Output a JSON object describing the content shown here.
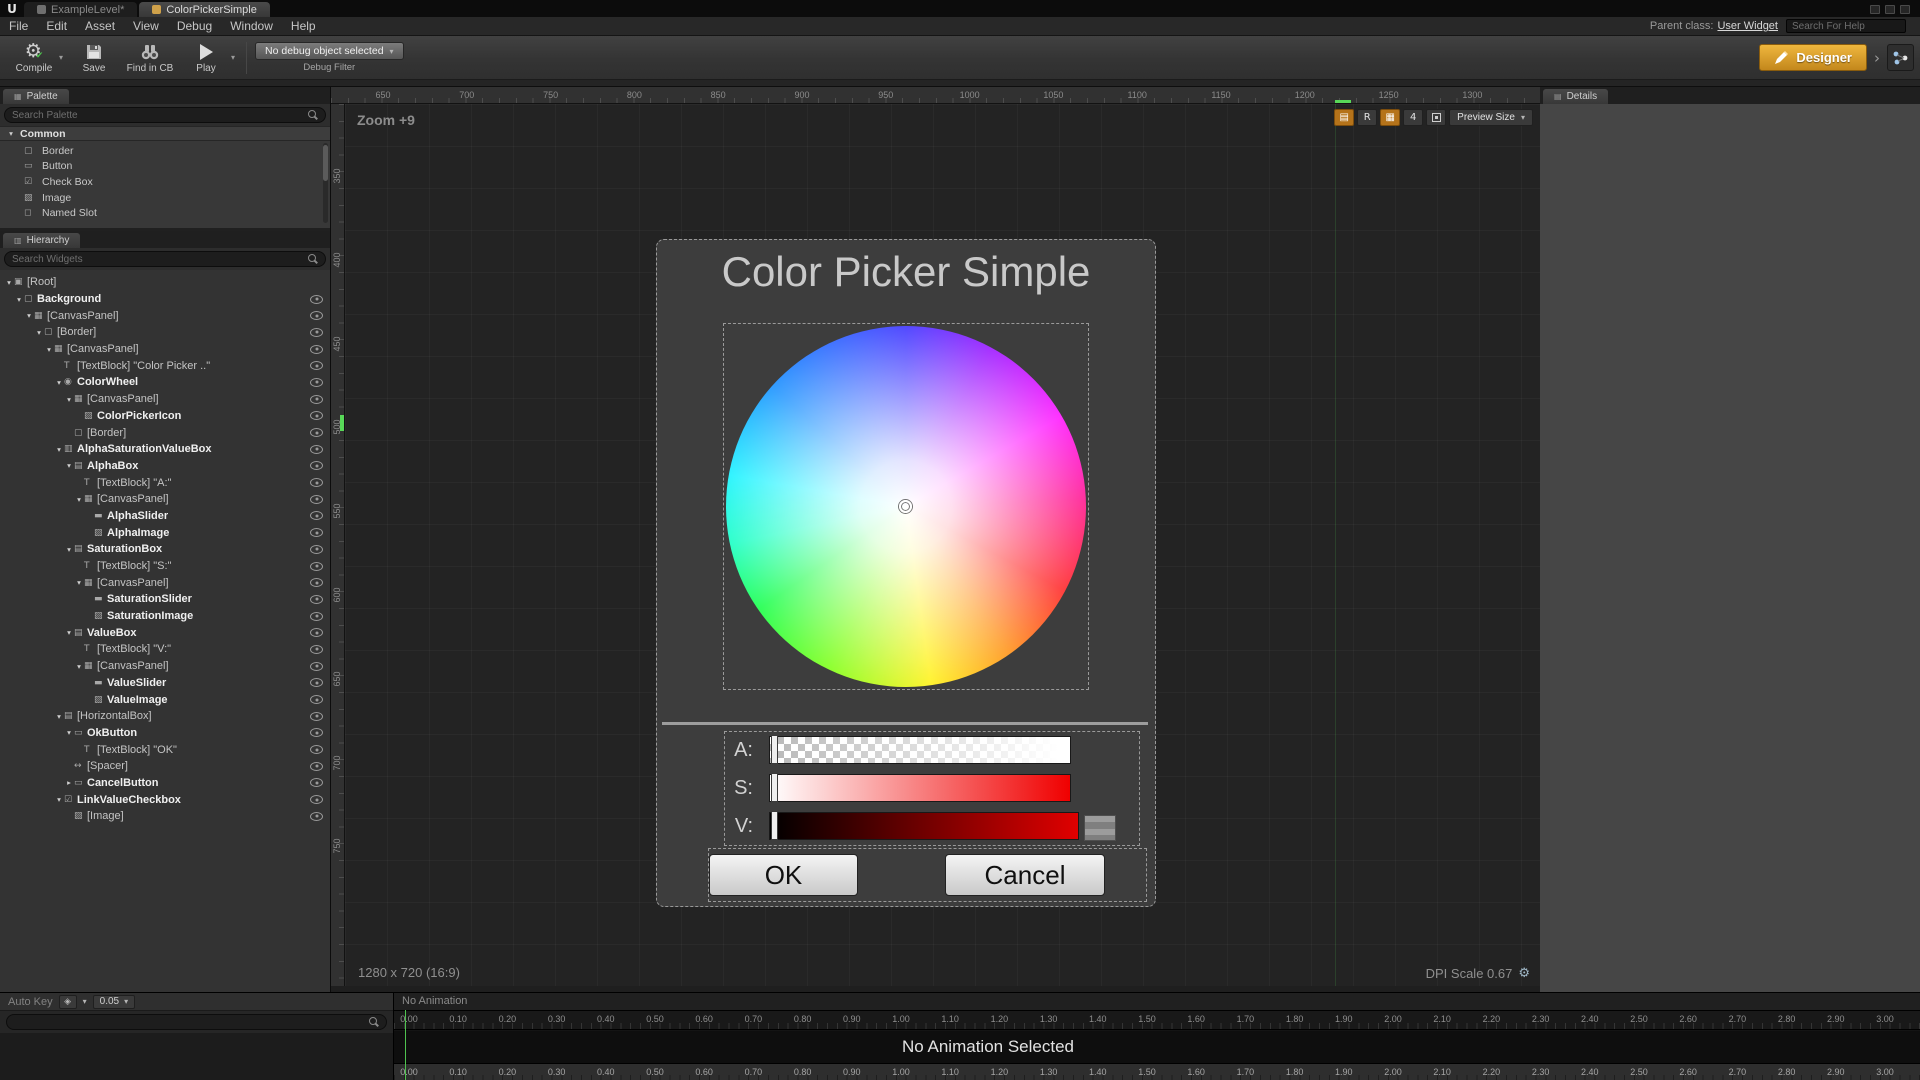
{
  "colors": {
    "accent_orange": "#c9861e",
    "playhead_green": "#4fc24f",
    "guide_green": "#58d858"
  },
  "window": {
    "logo_letter": "U",
    "tabs": [
      {
        "label": "ExampleLevel*"
      },
      {
        "label": "ColorPickerSimple"
      }
    ],
    "menus": [
      "File",
      "Edit",
      "Asset",
      "View",
      "Debug",
      "Window",
      "Help"
    ],
    "parent_class_label": "Parent class:",
    "parent_class_value": "User Widget",
    "help_search_placeholder": "Search For Help"
  },
  "toolbar": {
    "compile_label": "Compile",
    "save_label": "Save",
    "find_label": "Find in CB",
    "play_label": "Play",
    "debug_dropdown_value": "No debug object selected",
    "debug_filter_label": "Debug Filter",
    "designer_label": "Designer"
  },
  "palette": {
    "tab_label": "Palette",
    "search_placeholder": "Search Palette",
    "group_label": "Common",
    "items": [
      {
        "icon": "▢",
        "label": "Border"
      },
      {
        "icon": "▭",
        "label": "Button"
      },
      {
        "icon": "☑",
        "label": "Check Box"
      },
      {
        "icon": "▨",
        "label": "Image"
      },
      {
        "icon": "◻",
        "label": "Named Slot"
      }
    ]
  },
  "hierarchy": {
    "tab_label": "Hierarchy",
    "search_placeholder": "Search Widgets",
    "rows": [
      {
        "label": "[Root]",
        "depth": 0,
        "bold": false,
        "state": "e",
        "icon": "▣",
        "eye": false
      },
      {
        "label": "Background",
        "depth": 1,
        "bold": true,
        "state": "e",
        "icon": "▢"
      },
      {
        "label": "[CanvasPanel]",
        "depth": 2,
        "bold": false,
        "state": "e",
        "icon": "▦"
      },
      {
        "label": "[Border]",
        "depth": 3,
        "bold": false,
        "state": "e",
        "icon": "▢"
      },
      {
        "label": "[CanvasPanel]",
        "depth": 4,
        "bold": false,
        "state": "e",
        "icon": "▦"
      },
      {
        "label": "[TextBlock] \"Color Picker ..\"",
        "depth": 5,
        "bold": false,
        "state": "l",
        "icon": "T"
      },
      {
        "label": "ColorWheel",
        "depth": 5,
        "bold": true,
        "state": "e",
        "icon": "◉"
      },
      {
        "label": "[CanvasPanel]",
        "depth": 6,
        "bold": false,
        "state": "e",
        "icon": "▦"
      },
      {
        "label": "ColorPickerIcon",
        "depth": 7,
        "bold": true,
        "state": "l",
        "icon": "▨"
      },
      {
        "label": "[Border]",
        "depth": 6,
        "bold": false,
        "state": "l",
        "icon": "▢"
      },
      {
        "label": "AlphaSaturationValueBox",
        "depth": 5,
        "bold": true,
        "state": "e",
        "icon": "▥"
      },
      {
        "label": "AlphaBox",
        "depth": 6,
        "bold": true,
        "state": "e",
        "icon": "▤"
      },
      {
        "label": "[TextBlock] \"A:\"",
        "depth": 7,
        "bold": false,
        "state": "l",
        "icon": "T"
      },
      {
        "label": "[CanvasPanel]",
        "depth": 7,
        "bold": false,
        "state": "e",
        "icon": "▦"
      },
      {
        "label": "AlphaSlider",
        "depth": 8,
        "bold": true,
        "state": "l",
        "icon": "▬"
      },
      {
        "label": "AlphaImage",
        "depth": 8,
        "bold": true,
        "state": "l",
        "icon": "▨"
      },
      {
        "label": "SaturationBox",
        "depth": 6,
        "bold": true,
        "state": "e",
        "icon": "▤"
      },
      {
        "label": "[TextBlock] \"S:\"",
        "depth": 7,
        "bold": false,
        "state": "l",
        "icon": "T"
      },
      {
        "label": "[CanvasPanel]",
        "depth": 7,
        "bold": false,
        "state": "e",
        "icon": "▦"
      },
      {
        "label": "SaturationSlider",
        "depth": 8,
        "bold": true,
        "state": "l",
        "icon": "▬"
      },
      {
        "label": "SaturationImage",
        "depth": 8,
        "bold": true,
        "state": "l",
        "icon": "▨"
      },
      {
        "label": "ValueBox",
        "depth": 6,
        "bold": true,
        "state": "e",
        "icon": "▤"
      },
      {
        "label": "[TextBlock] \"V:\"",
        "depth": 7,
        "bold": false,
        "state": "l",
        "icon": "T"
      },
      {
        "label": "[CanvasPanel]",
        "depth": 7,
        "bold": false,
        "state": "e",
        "icon": "▦"
      },
      {
        "label": "ValueSlider",
        "depth": 8,
        "bold": true,
        "state": "l",
        "icon": "▬"
      },
      {
        "label": "ValueImage",
        "depth": 8,
        "bold": true,
        "state": "l",
        "icon": "▨"
      },
      {
        "label": "[HorizontalBox]",
        "depth": 5,
        "bold": false,
        "state": "e",
        "icon": "▤"
      },
      {
        "label": "OkButton",
        "depth": 6,
        "bold": true,
        "state": "e",
        "icon": "▭"
      },
      {
        "label": "[TextBlock] \"OK\"",
        "depth": 7,
        "bold": false,
        "state": "l",
        "icon": "T"
      },
      {
        "label": "[Spacer]",
        "depth": 6,
        "bold": false,
        "state": "l",
        "icon": "↔"
      },
      {
        "label": "CancelButton",
        "depth": 6,
        "bold": true,
        "state": "c",
        "icon": "▭"
      },
      {
        "label": "LinkValueCheckbox",
        "depth": 5,
        "bold": true,
        "state": "e",
        "icon": "☑"
      },
      {
        "label": "[Image]",
        "depth": 6,
        "bold": false,
        "state": "l",
        "icon": "▨"
      }
    ]
  },
  "designer": {
    "zoom_label": "Zoom +9",
    "h_ruler": [
      "650",
      "700",
      "750",
      "800",
      "850",
      "900",
      "950",
      "1000",
      "1050",
      "1100",
      "1150",
      "1200",
      "1250",
      "1300"
    ],
    "v_ruler": [
      "350",
      "400",
      "450",
      "500",
      "550",
      "600",
      "650",
      "700",
      "750"
    ],
    "view_toggles": [
      {
        "label": "▤",
        "active": true
      },
      {
        "label": "R",
        "active": false
      },
      {
        "label": "▦",
        "active": true
      },
      {
        "label": "4",
        "active": false
      }
    ],
    "preview_size_label": "Preview Size",
    "resolution_label": "1280 x 720 (16:9)",
    "dpi_label": "DPI Scale 0.67",
    "widget": {
      "title": "Color Picker Simple",
      "sliders": [
        {
          "label": "A:",
          "type": "alpha"
        },
        {
          "label": "S:",
          "type": "saturation"
        },
        {
          "label": "V:",
          "type": "value"
        }
      ],
      "ok_label": "OK",
      "cancel_label": "Cancel"
    }
  },
  "details": {
    "tab_label": "Details"
  },
  "timeline": {
    "auto_key_label": "Auto Key",
    "rate_value": "0.05",
    "no_animation_label": "No Animation",
    "empty_message": "No Animation Selected",
    "ticks": [
      "0.00",
      "0.10",
      "0.20",
      "0.30",
      "0.40",
      "0.50",
      "0.60",
      "0.70",
      "0.80",
      "0.90",
      "1.00",
      "1.10",
      "1.20",
      "1.30",
      "1.40",
      "1.50",
      "1.60",
      "1.70",
      "1.80",
      "1.90",
      "2.00",
      "2.10",
      "2.20",
      "2.30",
      "2.40",
      "2.50",
      "2.60",
      "2.70",
      "2.80",
      "2.90",
      "3.00"
    ]
  }
}
